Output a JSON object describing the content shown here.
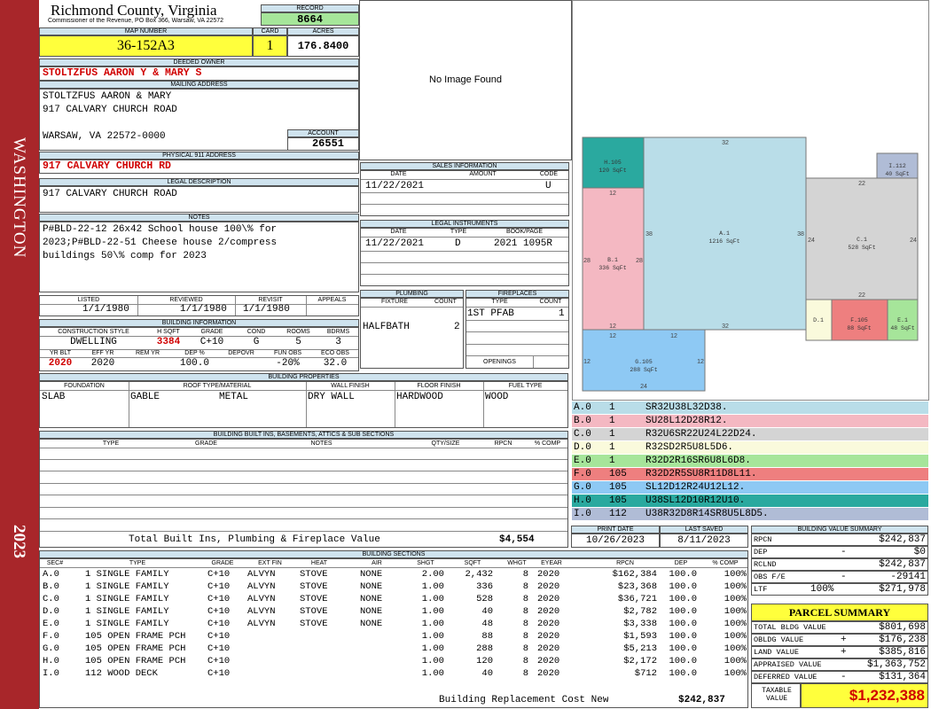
{
  "sidebar": {
    "county": "WASHINGTON",
    "year": "2023"
  },
  "header": {
    "title": "Richmond County, Virginia",
    "subtitle": "Commissioner of the Revenue, PO Box 366, Warsaw, VA 22572",
    "record_label": "RECORD",
    "record": "8664",
    "map_label": "MAP NUMBER",
    "map": "36-152A3",
    "card_label": "CARD",
    "card": "1",
    "acres_label": "ACRES",
    "acres": "176.8400"
  },
  "owner": {
    "deeded_label": "DEEDED OWNER",
    "deeded": "STOLTZFUS AARON Y & MARY S",
    "mailing_label": "MAILING ADDRESS",
    "mailing_lines": [
      "STOLTZFUS AARON & MARY",
      "917 CALVARY CHURCH ROAD",
      "",
      "WARSAW, VA 22572-0000"
    ],
    "account_label": "ACCOUNT",
    "account": "26551",
    "physical_label": "PHYSICAL 911 ADDRESS",
    "physical": "917 CALVARY CHURCH RD",
    "legal_label": "LEGAL DESCRIPTION",
    "legal": "917 CALVARY CHURCH ROAD",
    "notes_label": "NOTES",
    "notes_lines": [
      "P#BLD-22-12 26x42 School house 100\\% for",
      "2023;P#BLD-22-51 Cheese house 2/compress",
      "buildings 50\\% comp for 2023"
    ]
  },
  "photo": {
    "text": "No Image Found"
  },
  "sales": {
    "label": "SALES INFORMATION",
    "cols": [
      "DATE",
      "AMOUNT",
      "CODE"
    ],
    "date": "11/22/2021",
    "amount": "",
    "code": "U"
  },
  "legal_instr": {
    "label": "LEGAL INSTRUMENTS",
    "cols": [
      "DATE",
      "TYPE",
      "BOOK/PAGE"
    ],
    "date": "11/22/2021",
    "type": "D",
    "book": "2021 1095R"
  },
  "plumbing": {
    "label": "PLUMBING",
    "cols": [
      "FIXTURE",
      "COUNT"
    ],
    "fixture": "HALFBATH",
    "count": "2"
  },
  "fireplaces": {
    "label": "FIREPLACES",
    "cols": [
      "TYPE",
      "COUNT"
    ],
    "type": "1ST PFAB",
    "count": "1",
    "openings_label": "OPENINGS"
  },
  "dates": {
    "listed_label": "LISTED",
    "listed": "1/1/1980",
    "reviewed_label": "REVIEWED",
    "reviewed": "1/1/1980",
    "revisit_label": "REVISIT",
    "revisit": "1/1/1980",
    "appeals_label": "APPEALS",
    "appeals": ""
  },
  "building_info": {
    "label": "BUILDING INFORMATION",
    "cols": [
      "CONSTRUCTION STYLE",
      "H SQFT",
      "GRADE",
      "COND",
      "ROOMS",
      "BDRMS"
    ],
    "style": "DWELLING",
    "hsqft": "3384",
    "grade": "C+10",
    "cond": "G",
    "rooms": "5",
    "bdrms": "3",
    "cols2": [
      "YR BLT",
      "EFF YR",
      "REM YR",
      "DEP %",
      "DEPOVR",
      "FUN OBS",
      "ECO OBS"
    ],
    "yrblt": "2020",
    "effyr": "2020",
    "remyr": "",
    "dep": "100.0",
    "depovr": "",
    "funobs": "-20%",
    "ecoobs": "32.0"
  },
  "building_props": {
    "label": "BUILDING PROPERTIES",
    "cols": [
      "FOUNDATION",
      "ROOF TYPE/MATERIAL",
      "WALL FINISH",
      "FLOOR FINISH",
      "FUEL TYPE"
    ],
    "foundation": "SLAB",
    "roof_type": "GABLE",
    "roof_mat": "METAL",
    "wall": "DRY WALL",
    "floor": "HARDWOOD",
    "fuel": "WOOD"
  },
  "builtins": {
    "label": "BUILDING BUILT INS, BASEMENTS, ATTICS & SUB SECTIONS",
    "cols": [
      "TYPE",
      "GRADE",
      "NOTES",
      "QTY/SIZE",
      "RPCN",
      "% COMP"
    ],
    "total_label": "Total Built Ins, Plumbing & Fireplace Value",
    "total": "$4,554"
  },
  "print": {
    "print_label": "PRINT DATE",
    "print": "10/26/2023",
    "saved_label": "LAST SAVED",
    "saved": "8/11/2023"
  },
  "sketch": {
    "labels": [
      {
        "id": "H.105",
        "sq": "120 SqFt"
      },
      {
        "id": "A.1",
        "sq": "1216 SqFt"
      },
      {
        "id": "I.112",
        "sq": "40 SqFt"
      },
      {
        "id": "B.1",
        "sq": "336 SqFt"
      },
      {
        "id": "C.1",
        "sq": "528 SqFt"
      },
      {
        "id": "D.1",
        "sq": ""
      },
      {
        "id": "F.105",
        "sq": "88 SqFt"
      },
      {
        "id": "E.1",
        "sq": "48 SqFt"
      },
      {
        "id": "G.105",
        "sq": "288 SqFt"
      }
    ],
    "dims": [
      "32",
      "12",
      "38",
      "38",
      "22",
      "24",
      "24",
      "28",
      "28",
      "22",
      "12",
      "12",
      "32",
      "12",
      "12",
      "24"
    ],
    "codes": [
      {
        "sec": "A.0",
        "n": "1",
        "code": "SR32U38L32D38.",
        "color": "#b9dde8"
      },
      {
        "sec": "B.0",
        "n": "1",
        "code": "SU28L12D28R12.",
        "color": "#f4b8c2"
      },
      {
        "sec": "C.0",
        "n": "1",
        "code": "R32U6SR22U24L22D24.",
        "color": "#d4d4d4"
      },
      {
        "sec": "D.0",
        "n": "1",
        "code": "R32SD2R5U8L5D6.",
        "color": "#fafadc"
      },
      {
        "sec": "E.0",
        "n": "1",
        "code": "R32D2R16SR6U8L6D8.",
        "color": "#a6e59a"
      },
      {
        "sec": "F.0",
        "n": "105",
        "code": "R32D2R5SU8R11D8L11.",
        "color": "#ee7f7f"
      },
      {
        "sec": "G.0",
        "n": "105",
        "code": "SL12D12R24U12L12.",
        "color": "#8ec9f4"
      },
      {
        "sec": "H.0",
        "n": "105",
        "code": "U38SL12D10R12U10.",
        "color": "#2aa99f"
      },
      {
        "sec": "I.0",
        "n": "112",
        "code": "U38R32D8R14SR8U5L8D5.",
        "color": "#b0bcd6"
      }
    ]
  },
  "bvs": {
    "label": "BUILDING VALUE SUMMARY",
    "rows": [
      {
        "lab": "RPCN",
        "sign": "",
        "pct": "",
        "val": "$242,837"
      },
      {
        "lab": "DEP",
        "sign": "-",
        "pct": "",
        "val": "$0"
      },
      {
        "lab": "RCLND",
        "sign": "",
        "pct": "",
        "val": "$242,837"
      },
      {
        "lab": "OBS F/E",
        "sign": "-",
        "pct": "",
        "val": "-29141"
      },
      {
        "lab": "LTF",
        "sign": "",
        "pct": "100%",
        "val": "$271,978"
      }
    ]
  },
  "parcel": {
    "label": "PARCEL SUMMARY",
    "rows": [
      {
        "lab": "TOTAL BLDG VALUE",
        "sign": "",
        "val": "$801,698"
      },
      {
        "lab": "OBLDG VALUE",
        "sign": "+",
        "val": "$176,238"
      },
      {
        "lab": "LAND VALUE",
        "sign": "+",
        "val": "$385,816"
      },
      {
        "lab": "APPRAISED VALUE",
        "sign": "",
        "val": "$1,363,752"
      },
      {
        "lab": "DEFERRED VALUE",
        "sign": "-",
        "val": "$131,364"
      }
    ],
    "taxable_label": "TAXABLE VALUE",
    "taxable": "$1,232,388"
  },
  "sections": {
    "label": "BUILDING SECTIONS",
    "cols": [
      "SEC#",
      "TYPE",
      "GRADE",
      "EXT FIN",
      "HEAT",
      "AIR",
      "SHGT",
      "SQFT",
      "WHGT",
      "EYEAR",
      "RPCN",
      "DEP",
      "% COMP"
    ],
    "rows": [
      [
        "A.0",
        "1 SINGLE FAMILY",
        "C+10",
        "ALVYN",
        "STOVE",
        "NONE",
        "2.00",
        "2,432",
        "8",
        "2020",
        "$162,384",
        "100.0",
        "100%"
      ],
      [
        "B.0",
        "1 SINGLE FAMILY",
        "C+10",
        "ALVYN",
        "STOVE",
        "NONE",
        "1.00",
        "336",
        "8",
        "2020",
        "$23,368",
        "100.0",
        "100%"
      ],
      [
        "C.0",
        "1 SINGLE FAMILY",
        "C+10",
        "ALVYN",
        "STOVE",
        "NONE",
        "1.00",
        "528",
        "8",
        "2020",
        "$36,721",
        "100.0",
        "100%"
      ],
      [
        "D.0",
        "1 SINGLE FAMILY",
        "C+10",
        "ALVYN",
        "STOVE",
        "NONE",
        "1.00",
        "40",
        "8",
        "2020",
        "$2,782",
        "100.0",
        "100%"
      ],
      [
        "E.0",
        "1 SINGLE FAMILY",
        "C+10",
        "ALVYN",
        "STOVE",
        "NONE",
        "1.00",
        "48",
        "8",
        "2020",
        "$3,338",
        "100.0",
        "100%"
      ],
      [
        "F.0",
        "105 OPEN FRAME PCH",
        "C+10",
        "",
        "",
        "",
        "1.00",
        "88",
        "8",
        "2020",
        "$1,593",
        "100.0",
        "100%"
      ],
      [
        "G.0",
        "105 OPEN FRAME PCH",
        "C+10",
        "",
        "",
        "",
        "1.00",
        "288",
        "8",
        "2020",
        "$5,213",
        "100.0",
        "100%"
      ],
      [
        "H.0",
        "105 OPEN FRAME PCH",
        "C+10",
        "",
        "",
        "",
        "1.00",
        "120",
        "8",
        "2020",
        "$2,172",
        "100.0",
        "100%"
      ],
      [
        "I.0",
        "112 WOOD DECK",
        "C+10",
        "",
        "",
        "",
        "1.00",
        "40",
        "8",
        "2020",
        "$712",
        "100.0",
        "100%"
      ]
    ],
    "total_label": "Building Replacement Cost New",
    "total": "$242,837"
  }
}
